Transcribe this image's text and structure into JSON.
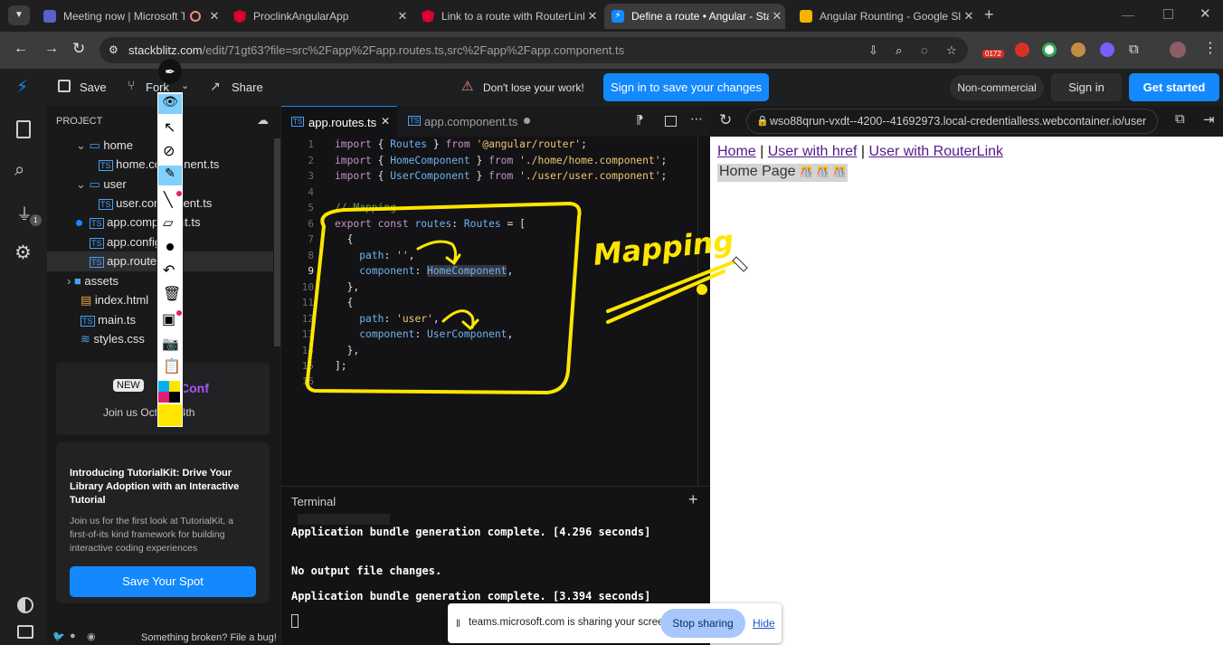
{
  "browser": {
    "tabs": [
      {
        "label": "Meeting now | Microsoft Te",
        "icon": "teams-icon",
        "color": "#5b5fc7"
      },
      {
        "label": "ProclinkAngularApp",
        "icon": "angular-icon",
        "color": "#dd0031"
      },
      {
        "label": "Link to a route with RouterLink",
        "icon": "angular-icon",
        "color": "#dd0031"
      },
      {
        "label": "Define a route • Angular - Stack",
        "icon": "stackblitz-icon",
        "color": "#1389fd"
      },
      {
        "label": "Angular Rounting - Google Slid",
        "icon": "slides-icon",
        "color": "#f4b400"
      }
    ],
    "new_tab": "+",
    "url_host": "stackblitz.com",
    "url_path": "/edit/71gt63?file=src%2Fapp%2Fapp.routes.ts,src%2Fapp%2Fapp.component.ts",
    "badge": "0172"
  },
  "topbar": {
    "save": "Save",
    "fork": "Fork",
    "share": "Share",
    "warning": "Don't lose your work!",
    "signin_save": "Sign in to save your changes",
    "noncommercial": "Non-commercial",
    "signin": "Sign in",
    "get_started": "Get started"
  },
  "explorer": {
    "title": "PROJECT",
    "items": [
      {
        "label": "home",
        "type": "folder-open"
      },
      {
        "label": "home.component.ts",
        "type": "ts"
      },
      {
        "label": "user",
        "type": "folder-open"
      },
      {
        "label": "user.component.ts",
        "type": "ts"
      },
      {
        "label": "app.component.ts",
        "type": "ts"
      },
      {
        "label": "app.config.ts",
        "type": "ts"
      },
      {
        "label": "app.routes.ts",
        "type": "ts"
      },
      {
        "label": "assets",
        "type": "folder"
      },
      {
        "label": "index.html",
        "type": "html"
      },
      {
        "label": "main.ts",
        "type": "ts"
      },
      {
        "label": "styles.css",
        "type": "css"
      }
    ],
    "promo_new": "NEW",
    "promo_conf": "Conf",
    "promo_join": "Join us Oct 3rd-4th",
    "card_title": "Introducing TutorialKit: Drive Your Library Adoption with an Interactive Tutorial",
    "card_body": "Join us for the first look at TutorialKit, a first-of-its kind framework for building interactive coding experiences",
    "card_btn": "Save Your Spot",
    "footer": "Something broken? File a bug!"
  },
  "editor": {
    "tabs": [
      {
        "label": "app.routes.ts"
      },
      {
        "label": "app.component.ts"
      }
    ],
    "line_numbers": [
      "1",
      "2",
      "3",
      "4",
      "5",
      "6",
      "7",
      "8",
      "9",
      "10",
      "11",
      "12",
      "13",
      "14",
      "15",
      "16"
    ],
    "annotation": "Mapping"
  },
  "terminal": {
    "title": "Terminal",
    "lines": [
      "Application bundle generation complete. [4.296 seconds]",
      "No output file changes.",
      "Application bundle generation complete. [3.394 seconds]"
    ]
  },
  "preview": {
    "url": "wso88qrun-vxdt--4200--41692973.local-credentialless.webcontainer.io/user",
    "links": [
      "Home",
      "User with href",
      "User with RouterLink"
    ],
    "sep": "|",
    "page_text": "Home Page"
  },
  "screenshare": {
    "text": "teams.microsoft.com is sharing your screen.",
    "stop": "Stop sharing",
    "hide": "Hide"
  }
}
